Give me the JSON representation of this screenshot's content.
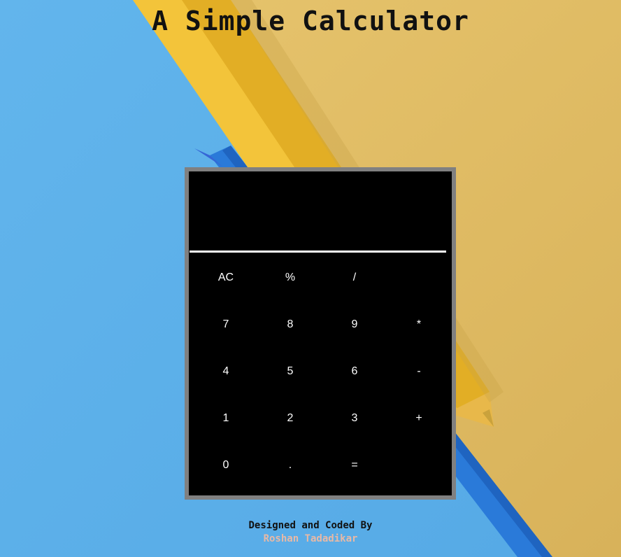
{
  "page": {
    "title": "A Simple Calculator",
    "background": {
      "left_paper_color": "#5ab0ea",
      "right_paper_color": "#e5c06a",
      "pencil_yellow": "#f2c230",
      "pencil_blue": "#2f7fe0"
    }
  },
  "calculator": {
    "display_value": "",
    "frame_color": "#808080",
    "body_color": "#000000",
    "key_text_color": "#ffffff",
    "keys": [
      "AC",
      "%",
      "/",
      "",
      "7",
      "8",
      "9",
      "*",
      "4",
      "5",
      "6",
      "-",
      "1",
      "2",
      "3",
      "+",
      "0",
      ".",
      "=",
      ""
    ]
  },
  "footer": {
    "line1": "Designed and Coded By",
    "line2": "Roshan Tadadikar",
    "line2_color": "#e8b9a6"
  }
}
